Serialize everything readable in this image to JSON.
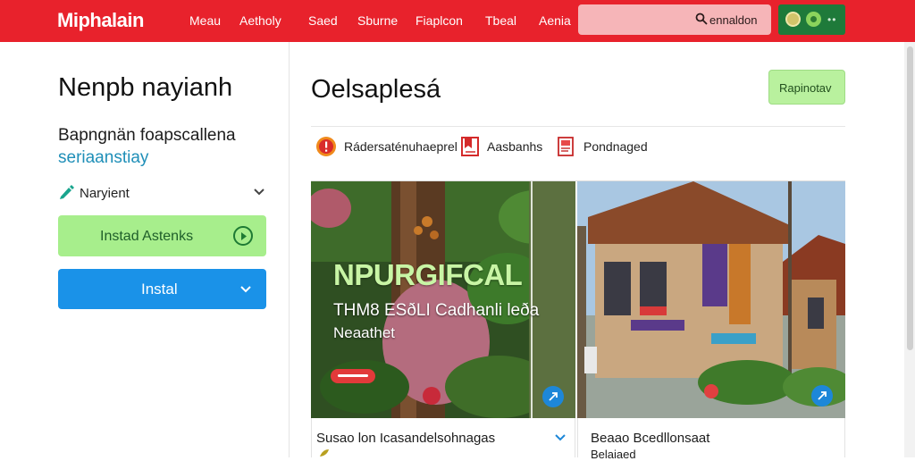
{
  "header": {
    "logo": "Miphalain",
    "nav": [
      "Meau",
      "Aetholy",
      "Saed",
      "Sburne",
      "Fiaplcon",
      "Tbeal",
      "Aenia"
    ],
    "search_text": "ennaldon",
    "colors": {
      "bar": "#e8222c",
      "search": "#f6b5b8",
      "account": "#1e7a3a"
    },
    "icons": {
      "search": "search-icon",
      "more": "more-dots-icon"
    }
  },
  "left_panel": {
    "title": "Nenpb nayianh",
    "subtitle_line1": "Bapngnän foapscallena",
    "subtitle_line2": "seriaanstiay",
    "variant_label": "Naryient",
    "install_green_label": "Instad Astenks",
    "install_blue_label": "Instal"
  },
  "right_panel": {
    "title": "Oelsaplesá",
    "action_button": "Rapinotav",
    "filter_tabs": [
      {
        "label": "Rádersaténuhaeprel",
        "icon": "info-icon"
      },
      {
        "label": "Aasbanhs",
        "icon": "bookmark-icon"
      },
      {
        "label": "Pondnaged",
        "icon": "document-icon"
      }
    ],
    "cards": [
      {
        "overlay_title": "NPURGIFCAL",
        "overlay_line1": "THM8 ESðLI Cadhanli leða",
        "overlay_line2": "Neaathet",
        "caption": "Susao lon Icasandelsohnagas"
      },
      {
        "caption": "Beaao Bcedllonsaat",
        "subcaption": "Belaiaed"
      }
    ]
  }
}
